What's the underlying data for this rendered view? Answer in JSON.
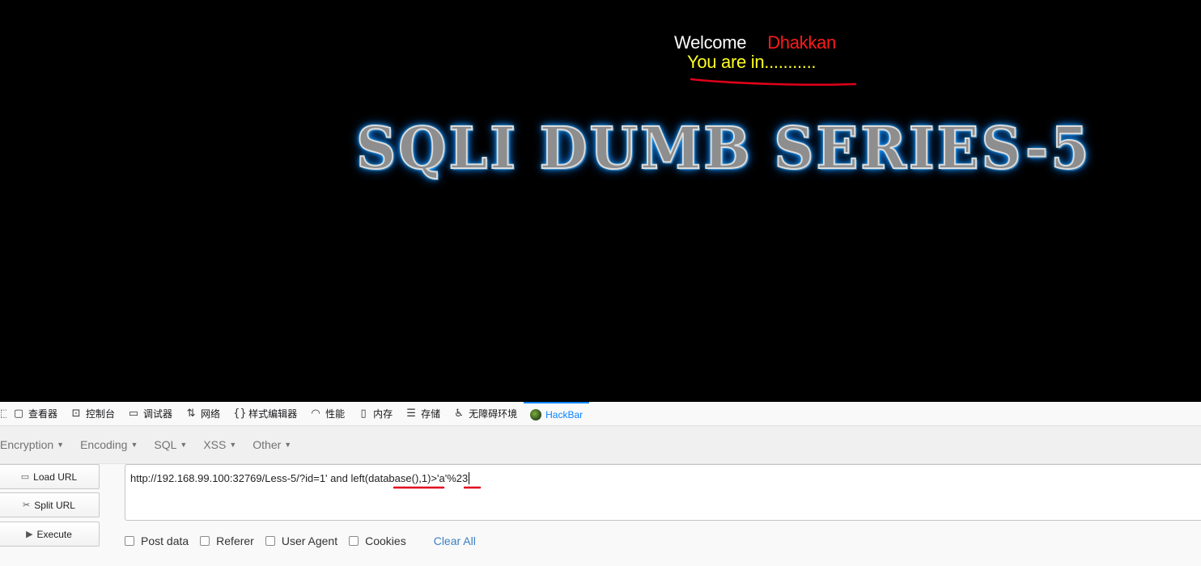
{
  "page": {
    "welcome_text": "Welcome",
    "user_name": "Dhakkan",
    "status_text": "You are in...........",
    "banner_text": "SQLI DUMB SERIES-5"
  },
  "devtools": {
    "tabs": [
      {
        "label": "查看器",
        "icon": "inspector-icon"
      },
      {
        "label": "控制台",
        "icon": "console-icon"
      },
      {
        "label": "调试器",
        "icon": "debugger-icon"
      },
      {
        "label": "网络",
        "icon": "network-icon"
      },
      {
        "label": "样式编辑器",
        "icon": "style-editor-icon"
      },
      {
        "label": "性能",
        "icon": "performance-icon"
      },
      {
        "label": "内存",
        "icon": "memory-icon"
      },
      {
        "label": "存储",
        "icon": "storage-icon"
      },
      {
        "label": "无障碍环境",
        "icon": "accessibility-icon"
      },
      {
        "label": "HackBar",
        "icon": "hackbar-icon",
        "active": true
      }
    ]
  },
  "hackbar": {
    "menu": [
      "Encryption",
      "Encoding",
      "SQL",
      "XSS",
      "Other"
    ],
    "buttons": {
      "load_url": "Load URL",
      "split_url": "Split URL",
      "execute": "Execute"
    },
    "url_value": "http://192.168.99.100:32769/Less-5/?id=1' and left(database(),1)>'a'%23",
    "options": [
      "Post data",
      "Referer",
      "User Agent",
      "Cookies"
    ],
    "clear_all": "Clear All"
  },
  "colors": {
    "active_tab": "#0a84ff",
    "user_name": "#ff1a1a",
    "status_text": "#ffff22",
    "annotation": "#e0001b"
  }
}
